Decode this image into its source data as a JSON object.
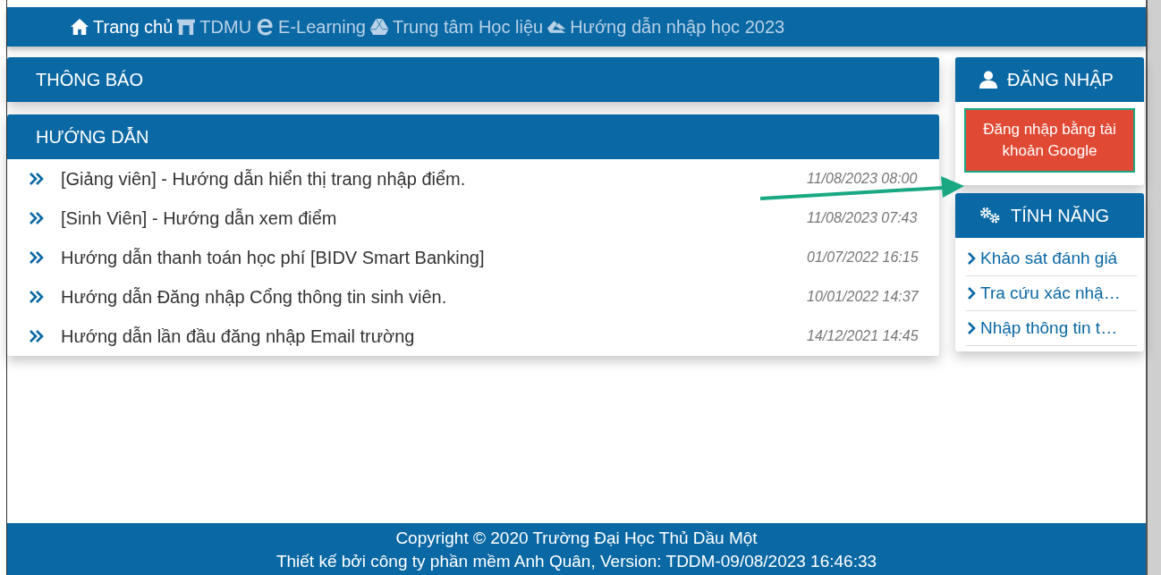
{
  "nav": {
    "items": [
      {
        "label": "Trang chủ",
        "selected": true
      },
      {
        "label": "TDMU",
        "selected": false
      },
      {
        "label": "E-Learning",
        "selected": false
      },
      {
        "label": "Trung tâm Học liệu",
        "selected": false
      },
      {
        "label": "Hướng dẫn nhập học 2023",
        "selected": false
      }
    ]
  },
  "notices": {
    "title": "THÔNG BÁO"
  },
  "guides": {
    "title": "HƯỚNG DẪN",
    "items": [
      {
        "title": "[Giảng viên] - Hướng dẫn hiển thị trang nhập điểm.",
        "date": "11/08/2023 08:00"
      },
      {
        "title": "[Sinh Viên] - Hướng dẫn xem điểm",
        "date": "11/08/2023 07:43"
      },
      {
        "title": "Hướng dẫn thanh toán học phí [BIDV Smart Banking]",
        "date": "01/07/2022 16:15"
      },
      {
        "title": "Hướng dẫn Đăng nhập Cổng thông tin sinh viên.",
        "date": "10/01/2022 14:37"
      },
      {
        "title": "Hướng dẫn lần đầu đăng nhập Email trường",
        "date": "14/12/2021 14:45"
      }
    ]
  },
  "login": {
    "title": "ĐĂNG NHẬP",
    "button": "Đăng nhập bằng tài khoản Google"
  },
  "features": {
    "title": "TÍNH NĂNG",
    "items": [
      "Khảo sát đánh giá",
      "Tra cứu xác nhậ…",
      "Nhập thông tin t…"
    ]
  },
  "footer": {
    "lines": [
      "Copyright © 2020 Trường Đại Học Thủ Dầu Một",
      "Thiết kế bởi công ty phần mềm Anh Quân, Version: TDDM-09/08/2023 16:46:33"
    ]
  },
  "annotation_arrow": true
}
